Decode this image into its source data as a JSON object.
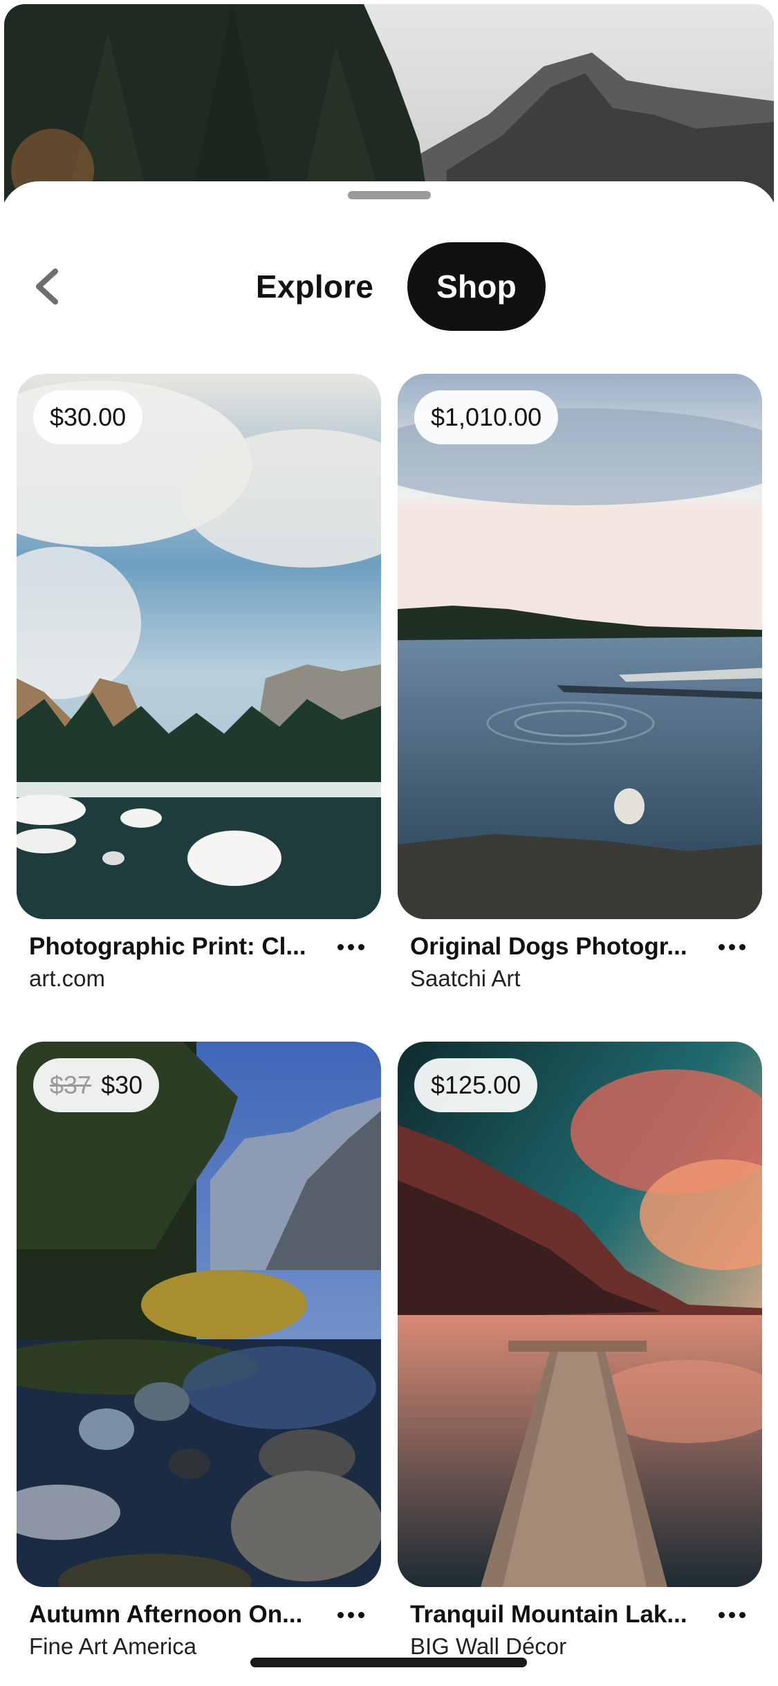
{
  "header": {
    "tabs": [
      {
        "label": "Explore",
        "active": false
      },
      {
        "label": "Shop",
        "active": true
      }
    ],
    "back_icon": "chevron-left-icon"
  },
  "products": [
    {
      "price": "$30.00",
      "old_price": "",
      "title": "Photographic Print: Cl...",
      "source": "art.com"
    },
    {
      "price": "$1,010.00",
      "old_price": "",
      "title": "Original Dogs Photogr...",
      "source": "Saatchi Art"
    },
    {
      "price": "$30",
      "old_price": "$37",
      "title": "Autumn Afternoon On...",
      "source": "Fine Art America"
    },
    {
      "price": "$125.00",
      "old_price": "",
      "title": "Tranquil Mountain Lak...",
      "source": "BIG Wall Décor"
    }
  ],
  "colors": {
    "active_tab_bg": "#111111",
    "price_pill_bg": "#ffffff"
  }
}
